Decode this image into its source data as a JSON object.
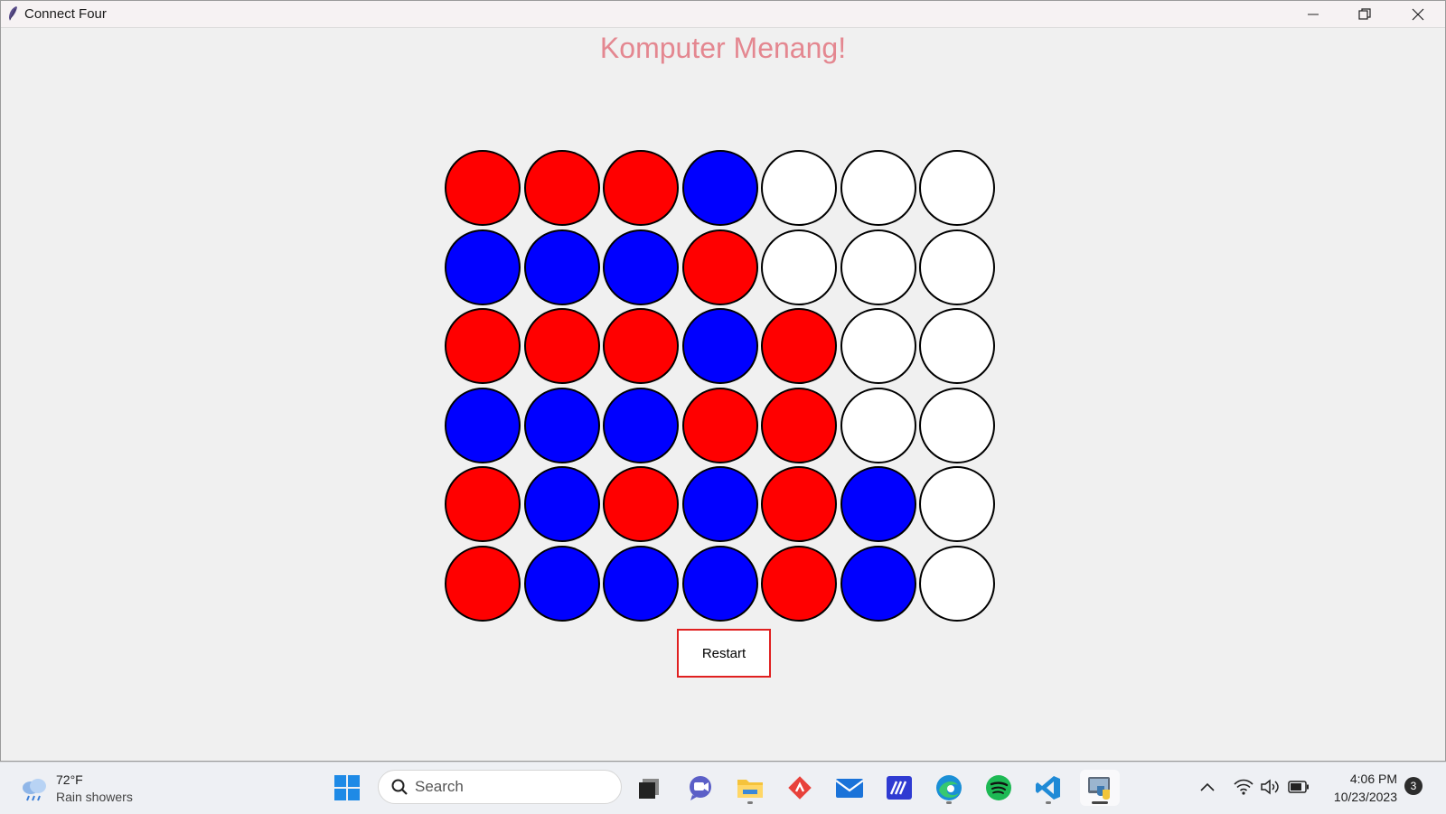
{
  "window": {
    "title": "Connect Four"
  },
  "game": {
    "status_text": "Komputer Menang!",
    "restart_label": "Restart",
    "colors": {
      "player1": "#ff0000",
      "player2": "#0000ff",
      "empty": "#ffffff",
      "status": "#e48790"
    },
    "board": [
      [
        "red",
        "red",
        "red",
        "blue",
        "empty",
        "empty",
        "empty"
      ],
      [
        "blue",
        "blue",
        "blue",
        "red",
        "empty",
        "empty",
        "empty"
      ],
      [
        "red",
        "red",
        "red",
        "blue",
        "red",
        "empty",
        "empty"
      ],
      [
        "blue",
        "blue",
        "blue",
        "red",
        "red",
        "empty",
        "empty"
      ],
      [
        "red",
        "blue",
        "red",
        "blue",
        "red",
        "blue",
        "empty"
      ],
      [
        "red",
        "blue",
        "blue",
        "blue",
        "red",
        "blue",
        "empty"
      ]
    ]
  },
  "taskbar": {
    "weather": {
      "temp": "72°F",
      "desc": "Rain showers",
      "icon": "cloud-rain-icon"
    },
    "search_placeholder": "Search",
    "pinned": [
      {
        "name": "windows-start-icon"
      },
      {
        "name": "task-view-icon"
      },
      {
        "name": "chat-icon"
      },
      {
        "name": "file-explorer-icon"
      },
      {
        "name": "git-app-icon"
      },
      {
        "name": "mail-icon"
      },
      {
        "name": "code-editor-icon"
      },
      {
        "name": "edge-browser-icon"
      },
      {
        "name": "spotify-icon"
      },
      {
        "name": "vscode-icon"
      },
      {
        "name": "python-app-icon"
      }
    ],
    "clock": {
      "time": "4:06 PM",
      "date": "10/23/2023"
    },
    "notification_count": "3"
  }
}
